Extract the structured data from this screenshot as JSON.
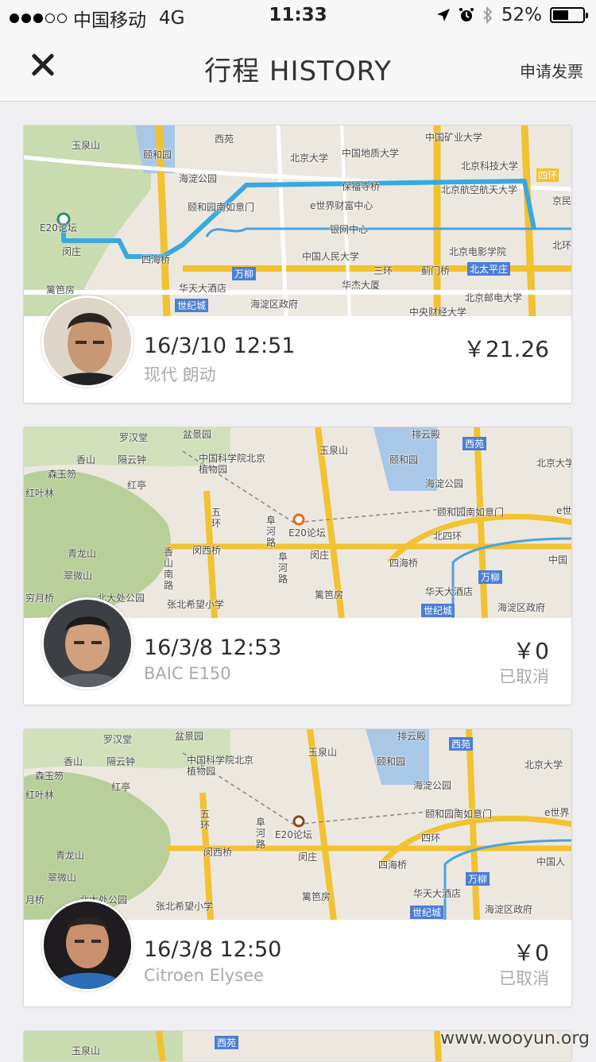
{
  "status_bar": {
    "carrier": "中国移动",
    "network": "4G",
    "time": "11:33",
    "battery": "52%",
    "battery_level": 0.52
  },
  "nav": {
    "title": "行程 HISTORY",
    "invoice_label": "申请发票"
  },
  "trips": [
    {
      "date": "16/3/10 12:51",
      "car": "现代 朗动",
      "price": "￥21.26",
      "status": "",
      "map_labels": [
        "玉泉山",
        "颐和园",
        "西苑",
        "北京大学",
        "中国地质大学",
        "中国矿业大学",
        "北京科技大学",
        "海淀公园",
        "颐和园南如意门",
        "e世界财富中心",
        "保福寺桥",
        "北京航空航天大学",
        "四环",
        "京民",
        "银网中心",
        "北京电影学院",
        "北环",
        "E20论坛",
        "闵庄",
        "四海桥",
        "中国人民大学",
        "三环",
        "蓟门桥",
        "北太平庄",
        "篱笆房",
        "华天大酒店",
        "万柳",
        "华杰大厦",
        "北京邮电大学",
        "世纪城",
        "海淀区政府",
        "中央财经大学"
      ]
    },
    {
      "date": "16/3/8 12:53",
      "car": "BAIC E150",
      "price": "￥0",
      "status": "已取消",
      "map_labels": [
        "罗汉堂",
        "盆景园",
        "排云殿",
        "西苑",
        "香山",
        "隔云钟",
        "玉泉山",
        "颐和园",
        "北京大学",
        "森玉笏",
        "中国科学院北京植物园",
        "红叶林",
        "红亭",
        "海淀公园",
        "颐和园南如意门",
        "e世",
        "五环",
        "阜河路",
        "E20论坛",
        "北四环",
        "青龙山",
        "闵西桥",
        "闵庄",
        "四海桥",
        "中国",
        "翠微山",
        "香山南路",
        "阜河路",
        "万柳",
        "穷月桥",
        "北大处公园",
        "篱笆房",
        "华天大酒店",
        "张北希望小学",
        "世纪城",
        "海淀区政府"
      ]
    },
    {
      "date": "16/3/8 12:50",
      "car": "Citroen Elysee",
      "price": "￥0",
      "status": "已取消",
      "map_labels": [
        "罗汉堂",
        "盆景园",
        "排云殿",
        "西苑",
        "香山",
        "隔云钟",
        "玉泉山",
        "颐和园",
        "北京大学",
        "森玉笏",
        "中国科学院北京植物园",
        "红叶林",
        "红亭",
        "海淀公园",
        "颐和园南如意门",
        "e世界",
        "五环",
        "阜河路",
        "E20论坛",
        "四环",
        "青龙山",
        "闵西桥",
        "闵庄",
        "四海桥",
        "中国人",
        "翠微山",
        "万柳",
        "月桥",
        "北太处公园",
        "篱笆房",
        "华天大酒店",
        "张北希望小学",
        "世纪城",
        "海淀区政府"
      ]
    }
  ],
  "partial_map_labels": [
    "玉泉山",
    "西苑"
  ],
  "watermark": "www.wooyun.org"
}
